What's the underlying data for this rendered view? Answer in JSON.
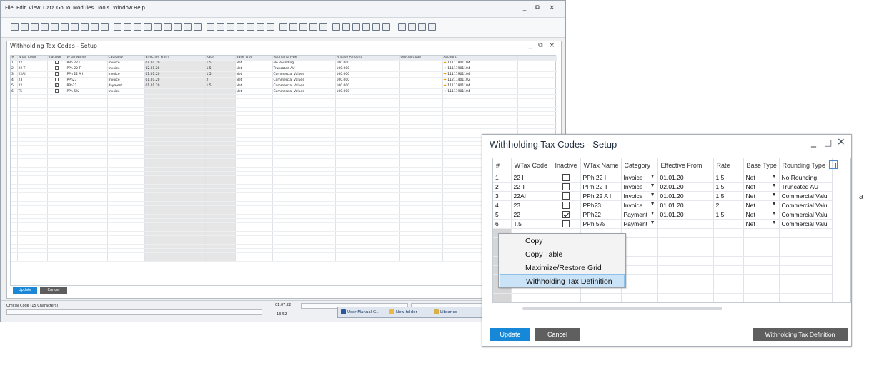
{
  "background_window": {
    "menu": [
      "File",
      "Edit",
      "View",
      "Data",
      "Go To",
      "Modules",
      "Tools",
      "Window",
      "Help"
    ],
    "window_controls": "_ ⧉ ×",
    "inner_title": "Withholding Tax Codes - Setup",
    "inner_controls": "_ ⧉ ×",
    "columns": [
      "#",
      "WTax Code",
      "Inactive",
      "WTax Name",
      "Category",
      "Effective From",
      "Rate",
      "Base Type",
      "Rounding Type",
      "% Base Amount",
      "Official Code",
      "Account"
    ],
    "rows": [
      {
        "num": "1",
        "code": "22 I",
        "inactive": false,
        "name": "PPh 22 I",
        "category": "Invoice",
        "from": "01.01.20",
        "rate": "1.5",
        "base": "Net",
        "rounding": "No Rounding",
        "pct": "100.000",
        "official": "",
        "account": "11111901104"
      },
      {
        "num": "2",
        "code": "22 T",
        "inactive": false,
        "name": "PPh 22 T",
        "category": "Invoice",
        "from": "02.01.20",
        "rate": "1.5",
        "base": "Net",
        "rounding": "Truncated AU",
        "pct": "100.000",
        "official": "",
        "account": "11111901104"
      },
      {
        "num": "3",
        "code": "22AI",
        "inactive": false,
        "name": "PPh 22 A I",
        "category": "Invoice",
        "from": "01.01.20",
        "rate": "1.5",
        "base": "Net",
        "rounding": "Commercial Values",
        "pct": "100.000",
        "official": "",
        "account": "11111901104"
      },
      {
        "num": "4",
        "code": "23",
        "inactive": false,
        "name": "PPh23",
        "category": "Invoice",
        "from": "01.01.20",
        "rate": "2",
        "base": "Net",
        "rounding": "Commercial Values",
        "pct": "100.000",
        "official": "",
        "account": "11211401102"
      },
      {
        "num": "5",
        "code": "22",
        "inactive": true,
        "name": "PPh22",
        "category": "Payment",
        "from": "01.01.20",
        "rate": "1.5",
        "base": "Net",
        "rounding": "Commercial Values",
        "pct": "100.000",
        "official": "",
        "account": "11111901104"
      },
      {
        "num": "6",
        "code": "T5",
        "inactive": false,
        "name": "PPh 5%",
        "category": "Invoice",
        "from": "",
        "rate": "",
        "base": "Net",
        "rounding": "Commercial Values",
        "pct": "100.000",
        "official": "",
        "account": "11111901104"
      }
    ],
    "update_label": "Update",
    "cancel_label": "Cancel",
    "status_message": "Official Code (15 Characters)",
    "status_date": "01.07.22",
    "status_time": "13:52",
    "taskbar": [
      "User Manual G...",
      "New folder",
      "Libraries"
    ]
  },
  "dialog": {
    "title": "Withholding Tax Codes - Setup",
    "columns": [
      "#",
      "WTax Code",
      "Inactive",
      "WTax Name",
      "Category",
      "Effective From",
      "Rate",
      "Base Type",
      "Rounding Type"
    ],
    "rows": [
      {
        "num": "1",
        "code": "22 I",
        "inactive": false,
        "name": "PPh 22 I",
        "category": "Invoice",
        "from": "01.01.20",
        "rate": "1.5",
        "base": "Net",
        "rounding": "No Rounding"
      },
      {
        "num": "2",
        "code": "22 T",
        "inactive": false,
        "name": "PPh 22 T",
        "category": "Invoice",
        "from": "02.01.20",
        "rate": "1.5",
        "base": "Net",
        "rounding": "Truncated AU"
      },
      {
        "num": "3",
        "code": "22AI",
        "inactive": false,
        "name": "PPh 22 A I",
        "category": "Invoice",
        "from": "01.01.20",
        "rate": "1.5",
        "base": "Net",
        "rounding": "Commercial Valu"
      },
      {
        "num": "4",
        "code": "23",
        "inactive": false,
        "name": "PPh23",
        "category": "Invoice",
        "from": "01.01.20",
        "rate": "2",
        "base": "Net",
        "rounding": "Commercial Valu"
      },
      {
        "num": "5",
        "code": "22",
        "inactive": true,
        "name": "PPh22",
        "category": "Payment",
        "from": "01.01.20",
        "rate": "1.5",
        "base": "Net",
        "rounding": "Commercial Valu"
      },
      {
        "num": "6",
        "code": "T.5",
        "inactive": false,
        "name": "PPh  5%",
        "category": "Payment",
        "from": "",
        "rate": "",
        "base": "Net",
        "rounding": "Commercial Valu"
      }
    ],
    "context_menu": [
      "Copy",
      "Copy Table",
      "Maximize/Restore Grid",
      "Withholding Tax Definition"
    ],
    "context_menu_highlighted": 3,
    "buttons": {
      "update": "Update",
      "cancel": "Cancel",
      "definition": "Withholding Tax Definition"
    },
    "stray_text": "a"
  },
  "colors": {
    "accent_blue": "#1787d8",
    "button_gray": "#5f5f5f",
    "grid_gray": "#d6d6d6",
    "menu_highlight": "#cbe3f6",
    "account_arrow": "#e8a000"
  }
}
